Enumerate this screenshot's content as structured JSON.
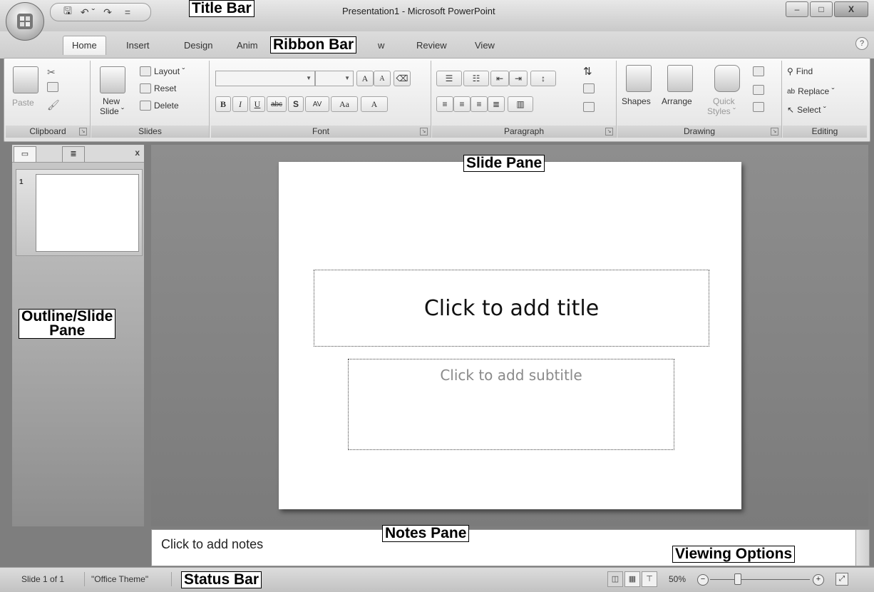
{
  "window": {
    "title": "Presentation1 - Microsoft PowerPoint",
    "controls": {
      "minimize": "–",
      "maximize": "□",
      "close": "X"
    }
  },
  "quick_access": {
    "save_icon": "save-icon",
    "undo_glyph": "↶ ˇ",
    "redo_glyph": "↷",
    "customize_glyph": "="
  },
  "tabs": [
    {
      "label": "Home",
      "active": true
    },
    {
      "label": "Insert"
    },
    {
      "label": "Design"
    },
    {
      "label": "Anim"
    },
    {
      "label": "w"
    },
    {
      "label": "Review"
    },
    {
      "label": "View"
    }
  ],
  "ribbon": {
    "clipboard": {
      "label": "Clipboard",
      "paste": "Paste"
    },
    "slides": {
      "label": "Slides",
      "new_slide_line1": "New",
      "new_slide_line2": "Slide ˇ",
      "layout": "Layout ˇ",
      "reset": "Reset",
      "delete": "Delete"
    },
    "font": {
      "label": "Font",
      "grow": "A",
      "shrink": "A",
      "bold": "B",
      "italic": "I",
      "underline": "U",
      "strike": "abc",
      "shadow": "S",
      "spacing": "AV",
      "case": "Aa",
      "color": "A"
    },
    "paragraph": {
      "label": "Paragraph"
    },
    "drawing": {
      "label": "Drawing",
      "shapes": "Shapes",
      "arrange": "Arrange",
      "quick_line1": "Quick",
      "quick_line2": "Styles ˇ"
    },
    "editing": {
      "label": "Editing",
      "find": "Find",
      "replace": "Replace ˇ",
      "select": "Select ˇ"
    }
  },
  "left_pane": {
    "close": "x",
    "slide_number": "1"
  },
  "slide": {
    "title_placeholder": "Click to add title",
    "subtitle_placeholder": "Click to add subtitle"
  },
  "notes": {
    "placeholder": "Click to add notes"
  },
  "status": {
    "slide_info": "Slide 1 of 1",
    "theme": "\"Office Theme\"",
    "zoom": "50%"
  },
  "callouts": {
    "title_bar": "Title Bar",
    "ribbon_bar": "Ribbon Bar",
    "slide_pane": "Slide Pane",
    "outline_line1": "Outline/Slide",
    "outline_line2": "Pane",
    "notes_pane": "Notes Pane",
    "viewing_options": "Viewing Options",
    "status_bar": "Status Bar"
  },
  "colors": {
    "chrome": "#d0d0d0",
    "workspace": "#7e7e7e",
    "slide": "#ffffff"
  }
}
